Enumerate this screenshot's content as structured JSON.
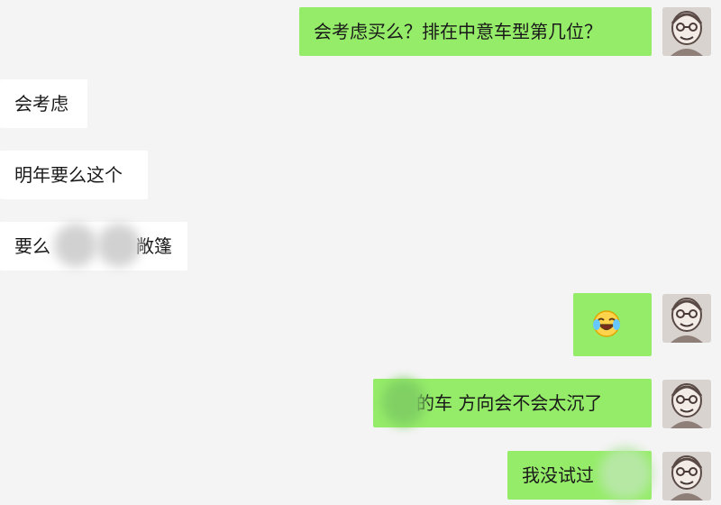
{
  "messages": [
    {
      "side": "sent",
      "text": "会考虑买么？排在中意车型第几位？"
    },
    {
      "side": "received",
      "text": "会考虑"
    },
    {
      "side": "received",
      "text": "明年要么这个"
    },
    {
      "side": "received",
      "text": "要么",
      "text_end": "敞篷"
    },
    {
      "side": "sent",
      "emoji": "laughing-with-tears-emoji"
    },
    {
      "side": "sent",
      "text": "的车  方向会不会太沉了"
    },
    {
      "side": "sent",
      "text": "我没试过"
    }
  ],
  "icons": {
    "avatar": "cartoon-man-avatar-icon",
    "emoji": "face-with-tears-of-joy-icon"
  },
  "colors": {
    "background": "#f4f4f4",
    "sent_bubble": "#95ec69",
    "received_bubble": "#ffffff",
    "text": "#191919"
  }
}
